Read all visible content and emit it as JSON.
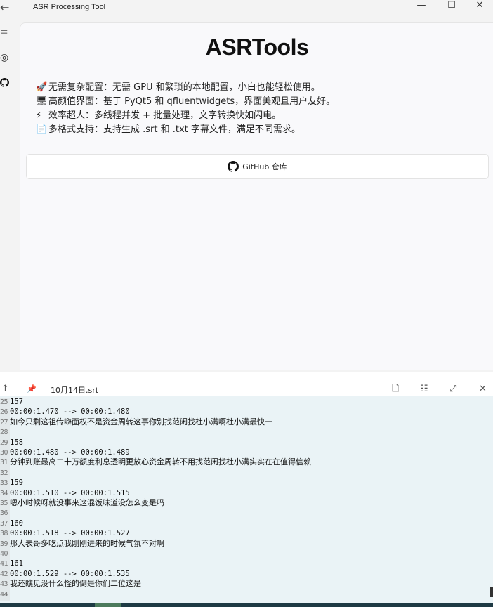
{
  "window": {
    "title": "ASR Processing Tool",
    "minimize_glyph": "—",
    "maximize_glyph": "☐",
    "close_glyph": "✕",
    "back_glyph": "←"
  },
  "nav": {
    "items": [
      {
        "icon": "menu-icon",
        "glyph": "≡"
      },
      {
        "icon": "record-icon",
        "glyph": "◎"
      },
      {
        "icon": "github-icon",
        "glyph": ""
      }
    ]
  },
  "main": {
    "heading": "ASRTools",
    "features": [
      {
        "icon": "rocket-icon",
        "glyph": "🚀",
        "text": "无需复杂配置：无需 GPU 和繁琐的本地配置，小白也能轻松使用。"
      },
      {
        "icon": "monitor-icon",
        "glyph": "🖥",
        "text": "高颜值界面：基于 PyQt5 和 qfluentwidgets，界面美观且用户友好。"
      },
      {
        "icon": "lightning-icon",
        "glyph": "⚡",
        "text": "效率超人：多线程并发 + 批量处理，文字转换快如闪电。"
      },
      {
        "icon": "document-icon",
        "glyph": "📄",
        "text": "多格式支持：支持生成 .srt 和 .txt 字幕文件，满足不同需求。"
      }
    ],
    "github_button": "GitHub 仓库"
  },
  "editor": {
    "filename": "10月14日.srt",
    "toolbar": {
      "up_glyph": "↑",
      "pin_glyph": "📌",
      "file_glyph": "🗋",
      "list_glyph": "☷",
      "expand_glyph": "⤢",
      "close_glyph": "✕"
    },
    "lines": [
      {
        "no": "25",
        "text": "157",
        "mono": true
      },
      {
        "no": "26",
        "text": "00:00:1.470 --> 00:00:1.480",
        "mono": true
      },
      {
        "no": "27",
        "text": "如今只剩这祖传噼面权不是资金周转这事你别找范闲找杜小满啊杜小满最快一",
        "mono": false
      },
      {
        "no": "28",
        "text": "",
        "mono": false
      },
      {
        "no": "29",
        "text": "158",
        "mono": true
      },
      {
        "no": "30",
        "text": "00:00:1.480 --> 00:00:1.489",
        "mono": true
      },
      {
        "no": "31",
        "text": "分钟到账最高二十万额度利息透明更放心资金周转不用找范闲找杜小满实实在在值得信赖",
        "mono": false
      },
      {
        "no": "32",
        "text": "",
        "mono": false
      },
      {
        "no": "33",
        "text": "159",
        "mono": true
      },
      {
        "no": "34",
        "text": "00:00:1.510 --> 00:00:1.515",
        "mono": true
      },
      {
        "no": "35",
        "text": "嗯小时候呀就没事来这混饭味道没怎么变是吗",
        "mono": false
      },
      {
        "no": "36",
        "text": "",
        "mono": false
      },
      {
        "no": "37",
        "text": "160",
        "mono": true
      },
      {
        "no": "38",
        "text": "00:00:1.518 --> 00:00:1.527",
        "mono": true
      },
      {
        "no": "39",
        "text": "那大表哥多吃点我刚刚进来的时候气氛不对啊",
        "mono": false
      },
      {
        "no": "40",
        "text": "",
        "mono": false
      },
      {
        "no": "41",
        "text": "161",
        "mono": true
      },
      {
        "no": "42",
        "text": "00:00:1.529 --> 00:00:1.535",
        "mono": true
      },
      {
        "no": "43",
        "text": "我还瞧见没什么怪的倒是你们二位这是",
        "mono": false
      },
      {
        "no": "44",
        "text": "",
        "mono": false
      }
    ]
  }
}
